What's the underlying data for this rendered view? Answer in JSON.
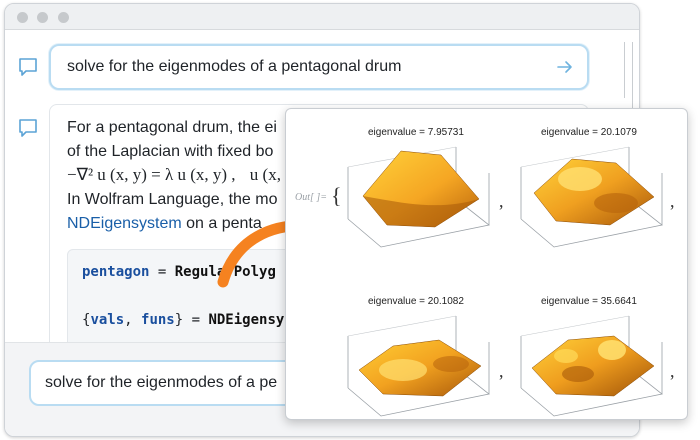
{
  "prompt": {
    "text": "solve for the eigenmodes of a pentagonal drum"
  },
  "response": {
    "line1": "For a pentagonal drum, the ei",
    "line2": "of the Laplacian with fixed bo",
    "line3_math": "−∇² u (x, y) = λ u (x, y) ,",
    "line3_tail": "u (x,",
    "line4": "In Wolfram Language, the mo",
    "line5_link": "NDEigensystem",
    "line5_tail": " on a penta",
    "code": {
      "line1_var": "pentagon",
      "line1_eq": " = ",
      "line1_fn": "RegularPolyg",
      "line2_open": "{",
      "line2_vals": "vals",
      "line2_comma": ", ",
      "line2_funs": "funs",
      "line2_close": "} = ",
      "line2_fn": "NDEigensy"
    }
  },
  "bottom_input": {
    "text": "solve for the eigenmodes of a pe"
  },
  "output": {
    "label": "Out[ ]=",
    "open_brace": "{",
    "comma": ",",
    "plots": [
      {
        "title": "eigenvalue = 7.95731"
      },
      {
        "title": "eigenvalue = 20.1079"
      },
      {
        "title": "eigenvalue = 20.1082"
      },
      {
        "title": "eigenvalue = 35.6641"
      }
    ]
  },
  "colors": {
    "accent": "#1a5fa8",
    "input_border": "#b9dcf2",
    "arrow": "#f58220",
    "surface": "#f5a623"
  }
}
